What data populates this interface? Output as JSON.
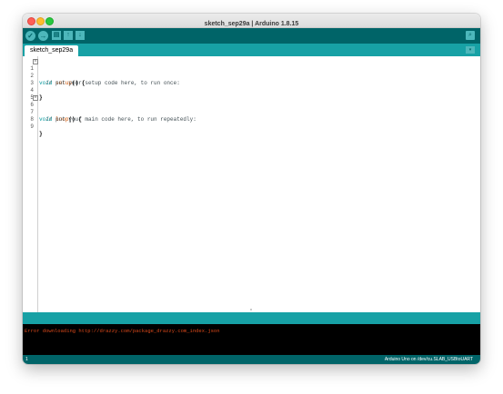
{
  "window": {
    "title": "sketch_sep29a | Arduino 1.8.15"
  },
  "toolbar": {
    "verify_icon": "✓",
    "upload_icon": "→",
    "new_icon": "▤",
    "open_icon": "↑",
    "save_icon": "↓",
    "serial_icon": "⌕"
  },
  "tabs": [
    {
      "label": "sketch_sep29a"
    }
  ],
  "tab_menu_icon": "▾",
  "code": [
    {
      "n": "1",
      "kw": "void",
      "fn": "setup",
      "rest": "() {",
      "fold": "⊟"
    },
    {
      "n": "2",
      "comment": "  // put your setup code here, to run once:"
    },
    {
      "n": "3"
    },
    {
      "n": "4",
      "brace": "}"
    },
    {
      "n": "5"
    },
    {
      "n": "6",
      "kw": "void",
      "fn": "loop",
      "rest": "() {",
      "fold": "⊟"
    },
    {
      "n": "7",
      "comment": "  // put your main code here, to run repeatedly:"
    },
    {
      "n": "8"
    },
    {
      "n": "9",
      "brace": "}"
    }
  ],
  "console": {
    "message": "Error downloading http://drazzy.com/package_drazzy.com_index.json"
  },
  "status": {
    "line": "1",
    "board": "Arduino Uno on /dev/cu.SLAB_USBtoUART"
  }
}
